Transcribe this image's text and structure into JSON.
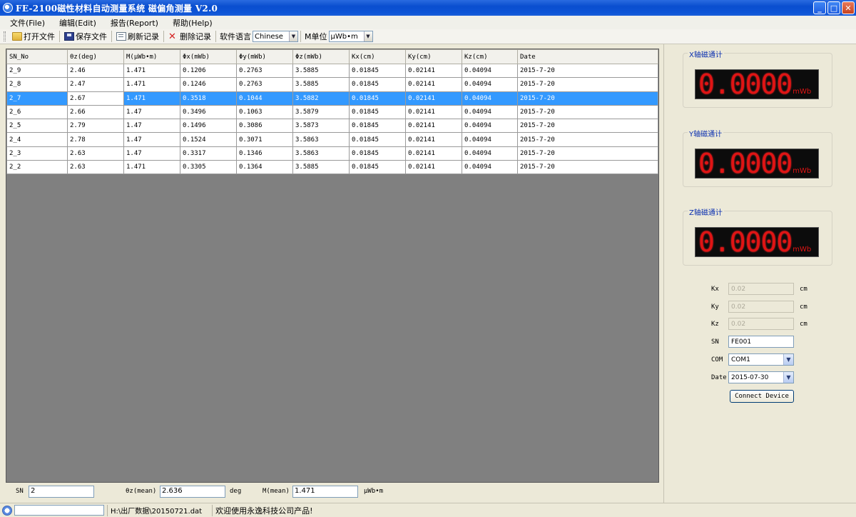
{
  "window": {
    "title": "FE-2100磁性材料自动测量系统 磁偏角测量 V2.0",
    "buttons": {
      "minimize": "_",
      "maximize": "□",
      "close": "✕"
    }
  },
  "menu": [
    {
      "label": "文件(File)"
    },
    {
      "label": "编辑(Edit)"
    },
    {
      "label": "报告(Report)"
    },
    {
      "label": "帮助(Help)"
    }
  ],
  "toolbar": {
    "open_file": "打开文件",
    "save_file": "保存文件",
    "refresh_records": "刷新记录",
    "delete_records": "删除记录",
    "language_label": "软件语言",
    "language_value": "Chinese",
    "unit_label": "M单位",
    "unit_value": "μWb•m"
  },
  "table": {
    "columns": [
      "SN_No",
      "θz(deg)",
      "M(μWb•m)",
      "Φx(mWb)",
      "Φy(mWb)",
      "Φz(mWb)",
      "Kx(cm)",
      "Ky(cm)",
      "Kz(cm)",
      "Date"
    ],
    "rows": [
      [
        "2_9",
        "2.46",
        "1.471",
        "0.1206",
        "0.2763",
        "3.5885",
        "0.01845",
        "0.02141",
        "0.04094",
        "2015-7-20"
      ],
      [
        "2_8",
        "2.47",
        "1.471",
        "0.1246",
        "0.2763",
        "3.5885",
        "0.01845",
        "0.02141",
        "0.04094",
        "2015-7-20"
      ],
      [
        "2_7",
        "2.67",
        "1.471",
        "0.3518",
        "0.1044",
        "3.5882",
        "0.01845",
        "0.02141",
        "0.04094",
        "2015-7-20"
      ],
      [
        "2_6",
        "2.66",
        "1.47",
        "0.3496",
        "0.1063",
        "3.5879",
        "0.01845",
        "0.02141",
        "0.04094",
        "2015-7-20"
      ],
      [
        "2_5",
        "2.79",
        "1.47",
        "0.1496",
        "0.3086",
        "3.5873",
        "0.01845",
        "0.02141",
        "0.04094",
        "2015-7-20"
      ],
      [
        "2_4",
        "2.78",
        "1.47",
        "0.1524",
        "0.3071",
        "3.5863",
        "0.01845",
        "0.02141",
        "0.04094",
        "2015-7-20"
      ],
      [
        "2_3",
        "2.63",
        "1.47",
        "0.3317",
        "0.1346",
        "3.5863",
        "0.01845",
        "0.02141",
        "0.04094",
        "2015-7-20"
      ],
      [
        "2_2",
        "2.63",
        "1.471",
        "0.3305",
        "0.1364",
        "3.5885",
        "0.01845",
        "0.02141",
        "0.04094",
        "2015-7-20"
      ]
    ],
    "selected_row": 2,
    "selection_color": "#3399ff"
  },
  "stats": {
    "sn_label": "SN",
    "sn_value": "2",
    "theta_label": "θz(mean)",
    "theta_value": "2.636",
    "theta_unit": "deg",
    "m_label": "M(mean)",
    "m_value": "1.471",
    "m_unit": "μWb•m"
  },
  "statusbar": {
    "path": "H:\\出厂数据\\20150721.dat",
    "message": "欢迎使用永逸科技公司产品!"
  },
  "gauges": [
    {
      "label": "X轴磁通计",
      "value": "0.0000",
      "unit": "mWb"
    },
    {
      "label": "Y轴磁通计",
      "value": "0.0000",
      "unit": "mWb"
    },
    {
      "label": "Z轴磁通计",
      "value": "0.0000",
      "unit": "mWb"
    }
  ],
  "device": {
    "kx_label": "Kx",
    "kx_value": "0.02",
    "kx_unit": "cm",
    "ky_label": "Ky",
    "ky_value": "0.02",
    "ky_unit": "cm",
    "kz_label": "Kz",
    "kz_value": "0.02",
    "kz_unit": "cm",
    "sn_label": "SN",
    "sn_value": "FE001",
    "com_label": "COM",
    "com_value": "COM1",
    "date_label": "Date",
    "date_value": "2015-07-30",
    "connect_label": "Connect Device"
  },
  "colors": {
    "lcd_digit": "#e01414",
    "gauge_legend": "#0a2fb0",
    "grid_background": "#808080"
  }
}
